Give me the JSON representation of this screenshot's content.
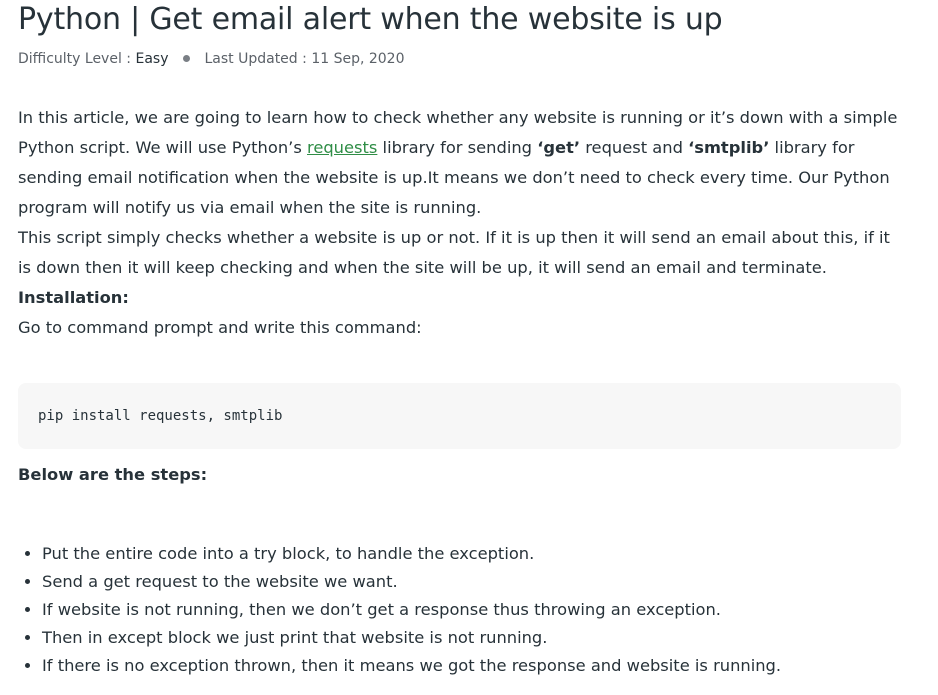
{
  "article": {
    "title": "Python | Get email alert when the website is up",
    "meta": {
      "difficulty_label": "Difficulty Level :",
      "difficulty_value": "Easy",
      "updated_label": "Last Updated :",
      "updated_value": "11 Sep, 2020"
    },
    "intro": {
      "part1": "In this article, we are going to learn how to check whether any website is running or it’s down with a simple Python script. We will use Python’s ",
      "link_text": "requests",
      "part2": " library for sending ",
      "bold1": "‘get’",
      "part3": " request and ",
      "bold2": "‘smtplib’",
      "part4": " library for sending email notification when the website is up.It means we don’t need to check every time. Our Python program will notify us via email when the site is running."
    },
    "paragraph2": "This script simply checks whether a website is up or not. If it is up then it will send an email about this, if it is down then it will keep checking and when the site will be up, it will send an email and terminate.",
    "installation_heading": "Installation:",
    "installation_text": "Go to command prompt and write this command:",
    "code": "pip install requests, smtplib",
    "steps_heading": "Below are the steps:",
    "steps": [
      "Put the entire code into a try block, to handle the exception.",
      "Send a get request to the website we want.",
      "If website is not running, then we don’t get a response thus throwing an exception.",
      "Then in except block we just print that website is not running.",
      "If there is no exception thrown, then it means we got the response and website is running."
    ]
  },
  "colors": {
    "text": "#273239",
    "link": "#2f8d46",
    "code_background": "#f7f7f7"
  }
}
